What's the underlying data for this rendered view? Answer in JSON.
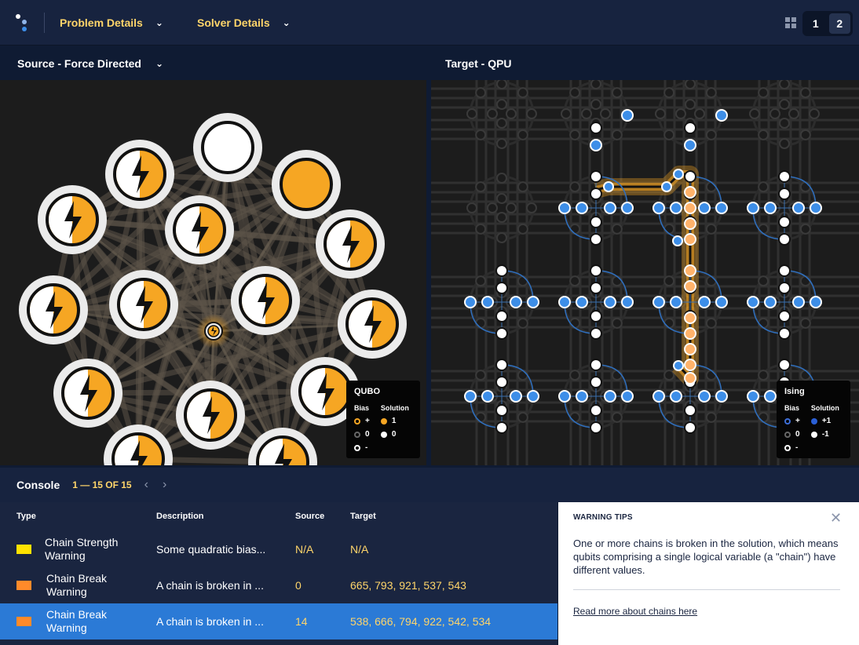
{
  "header": {
    "menus": [
      {
        "label": "Problem Details"
      },
      {
        "label": "Solver Details"
      }
    ],
    "tabs": [
      "1",
      "2"
    ],
    "active_tab": "2"
  },
  "source_pane": {
    "title": "Source - Force Directed",
    "legend": {
      "title": "QUBO",
      "bias_header": "Bias",
      "solution_header": "Solution",
      "bias": [
        "+",
        "0",
        "-"
      ],
      "solution": [
        "1",
        "0"
      ]
    }
  },
  "target_pane": {
    "title": "Target - QPU",
    "legend": {
      "title": "Ising",
      "bias_header": "Bias",
      "solution_header": "Solution",
      "bias": [
        "+",
        "0",
        "-"
      ],
      "solution": [
        "+1",
        "-1"
      ]
    }
  },
  "console": {
    "title": "Console",
    "count": "1 — 15 OF 15",
    "columns": [
      "Type",
      "Description",
      "Source",
      "Target"
    ],
    "rows": [
      {
        "type": "Chain Strength Warning",
        "description": "Some quadratic bias...",
        "source": "N/A",
        "target": "N/A",
        "color": "#ffe200"
      },
      {
        "type": "Chain Break Warning",
        "description": "A chain is broken in ...",
        "source": "0",
        "target": "665, 793, 921, 537, 543",
        "color": "#ff8a2a"
      },
      {
        "type": "Chain Break Warning",
        "description": "A chain is broken in ...",
        "source": "14",
        "target": "538, 666, 794, 922, 542, 534",
        "color": "#ff8a2a"
      }
    ],
    "selected_row": 2
  },
  "warning_tips": {
    "title": "WARNING TIPS",
    "body": "One or more chains is broken in the solution, which means qubits comprising a single logical variable (a \"chain\") have different values.",
    "link": "Read more about chains here"
  },
  "colors": {
    "accent": "#ffd56a",
    "orange": "#f6a623",
    "selected_row": "#2b7ad6",
    "qubit_blue": "#3d8ee8"
  },
  "icons": [
    "logo-icon",
    "chevron-down-icon",
    "layout-grid-icon",
    "chevron-left-icon",
    "chevron-right-icon",
    "close-icon",
    "lightning-bolt-icon"
  ]
}
